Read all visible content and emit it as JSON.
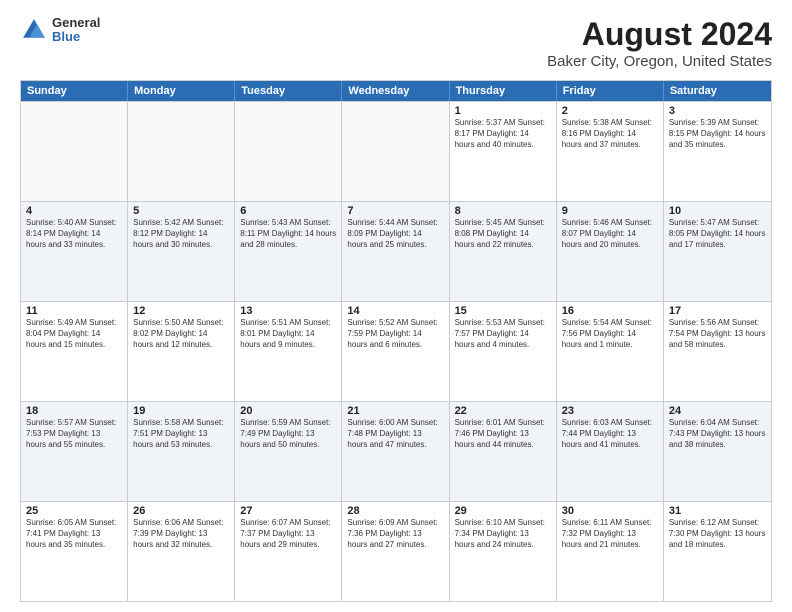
{
  "logo": {
    "general": "General",
    "blue": "Blue"
  },
  "header": {
    "title": "August 2024",
    "subtitle": "Baker City, Oregon, United States"
  },
  "weekdays": [
    "Sunday",
    "Monday",
    "Tuesday",
    "Wednesday",
    "Thursday",
    "Friday",
    "Saturday"
  ],
  "weeks": [
    [
      {
        "day": "",
        "info": ""
      },
      {
        "day": "",
        "info": ""
      },
      {
        "day": "",
        "info": ""
      },
      {
        "day": "",
        "info": ""
      },
      {
        "day": "1",
        "info": "Sunrise: 5:37 AM\nSunset: 8:17 PM\nDaylight: 14 hours\nand 40 minutes."
      },
      {
        "day": "2",
        "info": "Sunrise: 5:38 AM\nSunset: 8:16 PM\nDaylight: 14 hours\nand 37 minutes."
      },
      {
        "day": "3",
        "info": "Sunrise: 5:39 AM\nSunset: 8:15 PM\nDaylight: 14 hours\nand 35 minutes."
      }
    ],
    [
      {
        "day": "4",
        "info": "Sunrise: 5:40 AM\nSunset: 8:14 PM\nDaylight: 14 hours\nand 33 minutes."
      },
      {
        "day": "5",
        "info": "Sunrise: 5:42 AM\nSunset: 8:12 PM\nDaylight: 14 hours\nand 30 minutes."
      },
      {
        "day": "6",
        "info": "Sunrise: 5:43 AM\nSunset: 8:11 PM\nDaylight: 14 hours\nand 28 minutes."
      },
      {
        "day": "7",
        "info": "Sunrise: 5:44 AM\nSunset: 8:09 PM\nDaylight: 14 hours\nand 25 minutes."
      },
      {
        "day": "8",
        "info": "Sunrise: 5:45 AM\nSunset: 8:08 PM\nDaylight: 14 hours\nand 22 minutes."
      },
      {
        "day": "9",
        "info": "Sunrise: 5:46 AM\nSunset: 8:07 PM\nDaylight: 14 hours\nand 20 minutes."
      },
      {
        "day": "10",
        "info": "Sunrise: 5:47 AM\nSunset: 8:05 PM\nDaylight: 14 hours\nand 17 minutes."
      }
    ],
    [
      {
        "day": "11",
        "info": "Sunrise: 5:49 AM\nSunset: 8:04 PM\nDaylight: 14 hours\nand 15 minutes."
      },
      {
        "day": "12",
        "info": "Sunrise: 5:50 AM\nSunset: 8:02 PM\nDaylight: 14 hours\nand 12 minutes."
      },
      {
        "day": "13",
        "info": "Sunrise: 5:51 AM\nSunset: 8:01 PM\nDaylight: 14 hours\nand 9 minutes."
      },
      {
        "day": "14",
        "info": "Sunrise: 5:52 AM\nSunset: 7:59 PM\nDaylight: 14 hours\nand 6 minutes."
      },
      {
        "day": "15",
        "info": "Sunrise: 5:53 AM\nSunset: 7:57 PM\nDaylight: 14 hours\nand 4 minutes."
      },
      {
        "day": "16",
        "info": "Sunrise: 5:54 AM\nSunset: 7:56 PM\nDaylight: 14 hours\nand 1 minute."
      },
      {
        "day": "17",
        "info": "Sunrise: 5:56 AM\nSunset: 7:54 PM\nDaylight: 13 hours\nand 58 minutes."
      }
    ],
    [
      {
        "day": "18",
        "info": "Sunrise: 5:57 AM\nSunset: 7:53 PM\nDaylight: 13 hours\nand 55 minutes."
      },
      {
        "day": "19",
        "info": "Sunrise: 5:58 AM\nSunset: 7:51 PM\nDaylight: 13 hours\nand 53 minutes."
      },
      {
        "day": "20",
        "info": "Sunrise: 5:59 AM\nSunset: 7:49 PM\nDaylight: 13 hours\nand 50 minutes."
      },
      {
        "day": "21",
        "info": "Sunrise: 6:00 AM\nSunset: 7:48 PM\nDaylight: 13 hours\nand 47 minutes."
      },
      {
        "day": "22",
        "info": "Sunrise: 6:01 AM\nSunset: 7:46 PM\nDaylight: 13 hours\nand 44 minutes."
      },
      {
        "day": "23",
        "info": "Sunrise: 6:03 AM\nSunset: 7:44 PM\nDaylight: 13 hours\nand 41 minutes."
      },
      {
        "day": "24",
        "info": "Sunrise: 6:04 AM\nSunset: 7:43 PM\nDaylight: 13 hours\nand 38 minutes."
      }
    ],
    [
      {
        "day": "25",
        "info": "Sunrise: 6:05 AM\nSunset: 7:41 PM\nDaylight: 13 hours\nand 35 minutes."
      },
      {
        "day": "26",
        "info": "Sunrise: 6:06 AM\nSunset: 7:39 PM\nDaylight: 13 hours\nand 32 minutes."
      },
      {
        "day": "27",
        "info": "Sunrise: 6:07 AM\nSunset: 7:37 PM\nDaylight: 13 hours\nand 29 minutes."
      },
      {
        "day": "28",
        "info": "Sunrise: 6:09 AM\nSunset: 7:36 PM\nDaylight: 13 hours\nand 27 minutes."
      },
      {
        "day": "29",
        "info": "Sunrise: 6:10 AM\nSunset: 7:34 PM\nDaylight: 13 hours\nand 24 minutes."
      },
      {
        "day": "30",
        "info": "Sunrise: 6:11 AM\nSunset: 7:32 PM\nDaylight: 13 hours\nand 21 minutes."
      },
      {
        "day": "31",
        "info": "Sunrise: 6:12 AM\nSunset: 7:30 PM\nDaylight: 13 hours\nand 18 minutes."
      }
    ]
  ]
}
